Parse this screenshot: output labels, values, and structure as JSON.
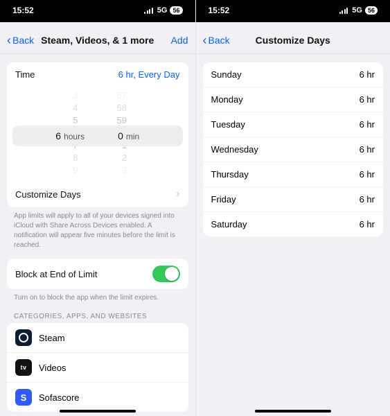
{
  "statusbar": {
    "time": "15:52",
    "network": "5G",
    "battery": "56"
  },
  "left": {
    "back": "Back",
    "title": "Steam, Videos, & 1 more",
    "add": "Add",
    "time_label": "Time",
    "time_value": "6 hr, Every Day",
    "picker": {
      "hours_faint_a": "3",
      "hours_b": "4",
      "hours_c": "5",
      "hours_sel": "6",
      "hours_unit": "hours",
      "hours_d": "7",
      "hours_e": "8",
      "hours_faint_f": "9",
      "mins_faint_a": "57",
      "mins_b": "58",
      "mins_c": "59",
      "mins_sel": "0",
      "mins_unit": "min",
      "mins_d": "1",
      "mins_e": "2",
      "mins_faint_f": "3"
    },
    "customize": "Customize Days",
    "footnote": "App limits will apply to all of your devices signed into iCloud with Share Across Devices enabled. A notification will appear five minutes before the limit is reached.",
    "block_label": "Block at End of Limit",
    "block_on": true,
    "block_hint": "Turn on to block the app when the limit expires.",
    "section": "CATEGORIES, APPS, AND WEBSITES",
    "apps": [
      {
        "name": "Steam",
        "icon": "steam"
      },
      {
        "name": "Videos",
        "icon": "videos"
      },
      {
        "name": "Sofascore",
        "icon": "sofa"
      }
    ]
  },
  "right": {
    "back": "Back",
    "title": "Customize Days",
    "days": [
      {
        "day": "Sunday",
        "val": "6 hr"
      },
      {
        "day": "Monday",
        "val": "6 hr"
      },
      {
        "day": "Tuesday",
        "val": "6 hr"
      },
      {
        "day": "Wednesday",
        "val": "6 hr"
      },
      {
        "day": "Thursday",
        "val": "6 hr"
      },
      {
        "day": "Friday",
        "val": "6 hr"
      },
      {
        "day": "Saturday",
        "val": "6 hr"
      }
    ]
  }
}
